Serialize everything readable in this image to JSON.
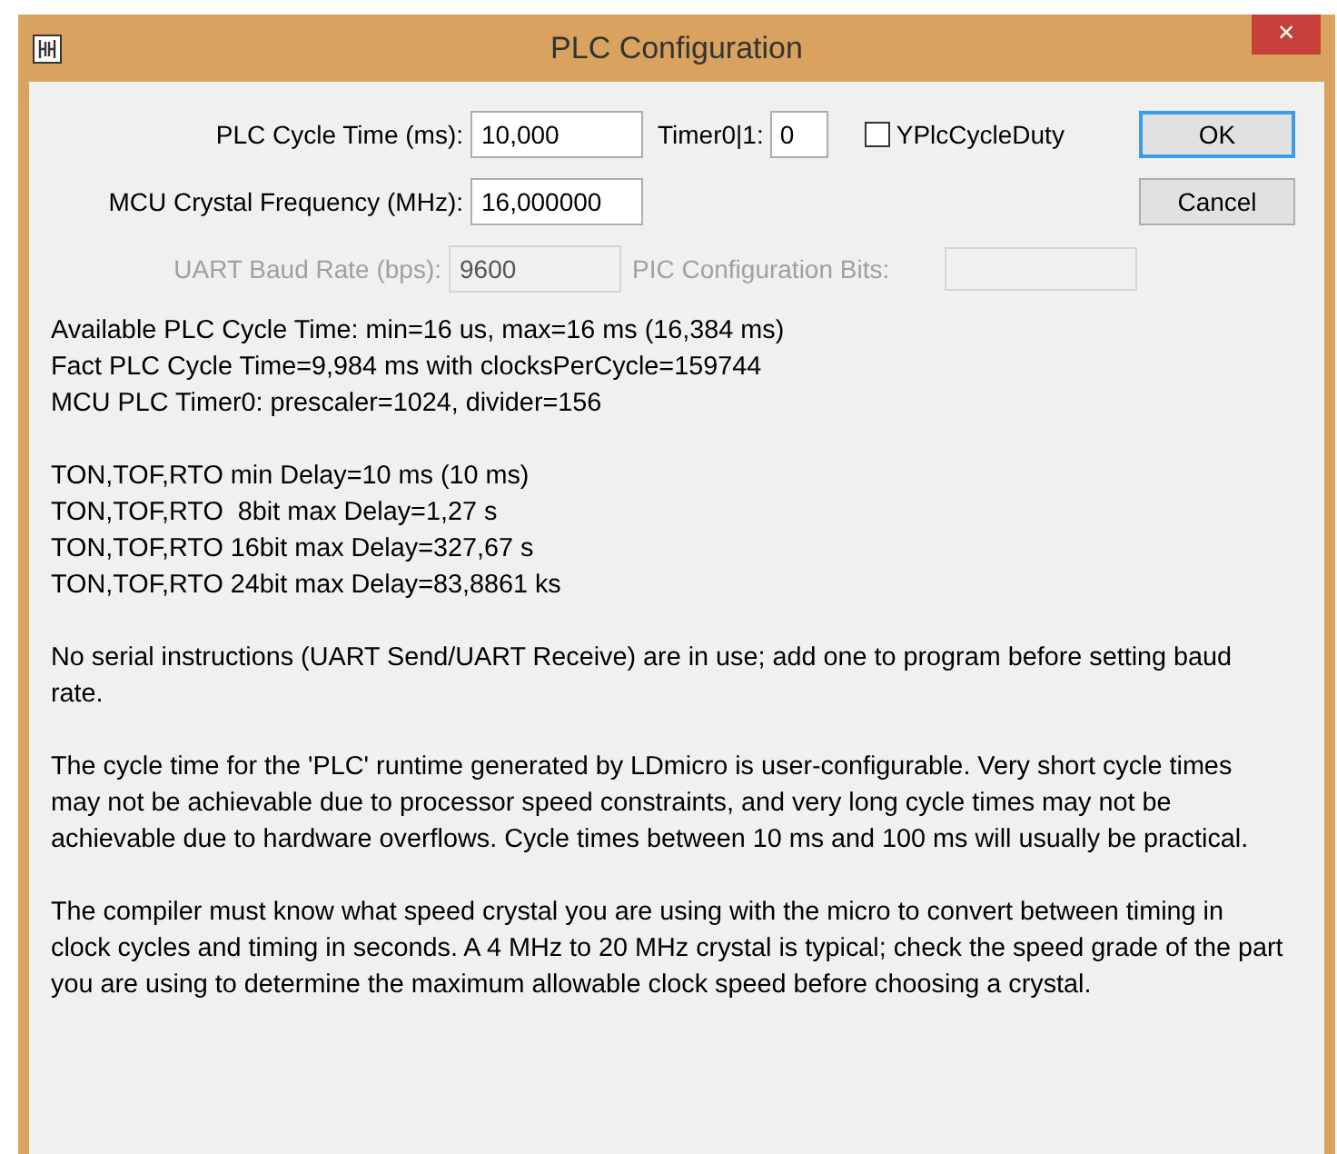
{
  "window": {
    "title": "PLC Configuration",
    "close": "×"
  },
  "fields": [
    {
      "label": "PLC Cycle Time (ms):",
      "value": "10,000",
      "disabled": false
    },
    {
      "label": "MCU Crystal Frequency (MHz):",
      "value": "16,000000",
      "disabled": false
    },
    {
      "label": "UART Baud Rate (bps):",
      "value": "9600",
      "disabled": true
    }
  ],
  "timer": {
    "label": "Timer0|1:",
    "value": "0"
  },
  "checkbox": {
    "label": "YPlcCycleDuty",
    "checked": false
  },
  "pic_bits": {
    "label": "PIC Configuration Bits:",
    "disabled": true
  },
  "buttons": [
    {
      "label": "OK",
      "default": true
    },
    {
      "label": "Cancel",
      "default": false
    }
  ],
  "info_groups": [
    [
      "Available PLC Cycle Time: min=16 us, max=16 ms (16,384 ms)",
      "Fact PLC Cycle Time=9,984 ms with clocksPerCycle=159744",
      "MCU PLC Timer0: prescaler=1024, divider=156"
    ],
    [
      "TON,TOF,RTO min Delay=10 ms (10 ms)",
      "TON,TOF,RTO  8bit max Delay=1,27 s",
      "TON,TOF,RTO 16bit max Delay=327,67 s",
      "TON,TOF,RTO 24bit max Delay=83,8861 ks"
    ]
  ],
  "paragraphs": [
    "No serial instructions (UART Send/UART Receive) are in use; add one to program before setting baud rate.",
    "The cycle time for the 'PLC' runtime generated by LDmicro is user-configurable. Very short cycle times may not be achievable due to processor speed constraints, and very long cycle times may not be achievable due to hardware overflows. Cycle times between 10 ms and 100 ms will usually be practical.",
    "The compiler must know what speed crystal you are using with the micro to convert between timing in clock cycles and timing in seconds. A 4 MHz to 20 MHz crystal is typical; check the speed grade of the part you are using to determine the maximum allowable clock speed before choosing a crystal."
  ]
}
